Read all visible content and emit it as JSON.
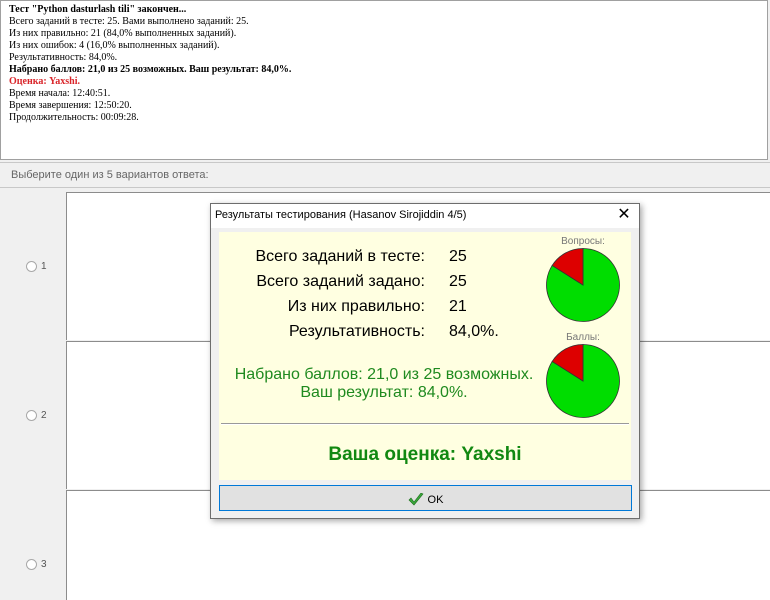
{
  "report": {
    "lines": [
      "Тест \"Python dasturlash tili\" закончен...",
      "Всего заданий в тесте: 25. Вами выполнено заданий: 25.",
      "Из них правильно: 21 (84,0% выполненных заданий).",
      "Из них ошибок: 4 (16,0% выполненных заданий).",
      "Результативность: 84,0%.",
      "Набрано баллов: 21,0 из 25 возможных. Ваш результат: 84,0%.",
      "Оценка: Yaxshi.",
      "Время начала: 12:40:51.",
      "Время завершения: 12:50:20.",
      "Продолжительность: 00:09:28."
    ]
  },
  "instruction": "Выберите один из 5 вариантов ответа:",
  "options": [
    "1",
    "2",
    "3"
  ],
  "dialog": {
    "title": "Результаты тестирования (Hasanov Sirojiddin 4/5)",
    "close_glyph": "✕",
    "stats": [
      {
        "label": "Всего заданий в тесте:",
        "value": "25"
      },
      {
        "label": "Всего заданий задано:",
        "value": "25"
      },
      {
        "label": "Из них правильно:",
        "value": "21"
      },
      {
        "label": "Результативность:",
        "value": "84,0%."
      }
    ],
    "score_line1": "Набрано баллов: 21,0 из 25 возможных.",
    "score_line2": "Ваш результат: 84,0%.",
    "pie_questions_label": "Вопросы:",
    "pie_points_label": "Баллы:",
    "pie_questions": {
      "correct": 21,
      "wrong": 4
    },
    "pie_points": {
      "scored": 21,
      "missed": 4
    },
    "grade": "Ваша оценка: Yaxshi",
    "ok_label": "OK",
    "colors": {
      "correct": "#00dd00",
      "wrong": "#dd0000",
      "grade": "#118811",
      "score_text": "#1f8a1f"
    }
  }
}
